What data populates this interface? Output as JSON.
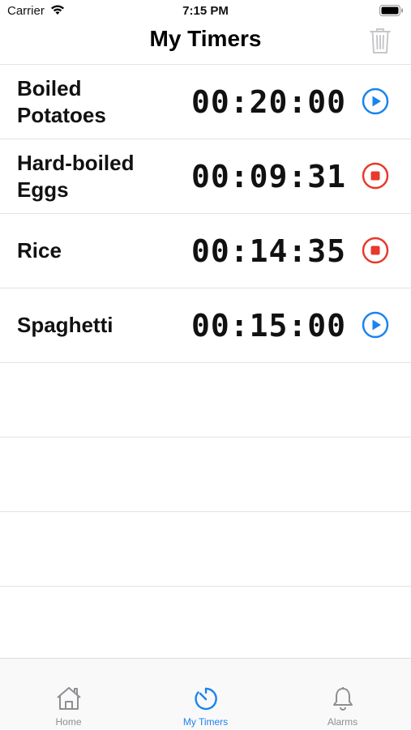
{
  "status_bar": {
    "carrier": "Carrier",
    "time": "7:15 PM"
  },
  "nav": {
    "title": "My Timers"
  },
  "timers": [
    {
      "name": "Boiled Potatoes",
      "time": "00:20:00",
      "state": "play"
    },
    {
      "name": "Hard-boiled Eggs",
      "time": "00:09:31",
      "state": "stop"
    },
    {
      "name": "Rice",
      "time": "00:14:35",
      "state": "stop"
    },
    {
      "name": "Spaghetti",
      "time": "00:15:00",
      "state": "play"
    }
  ],
  "tabs": [
    {
      "label": "Home",
      "icon": "house-icon",
      "active": false
    },
    {
      "label": "My Timers",
      "icon": "timer-icon",
      "active": true
    },
    {
      "label": "Alarms",
      "icon": "bell-icon",
      "active": false
    }
  ],
  "colors": {
    "accent": "#1a84ef",
    "stop": "#e8392b",
    "trash_disabled": "#c7c7cc"
  }
}
